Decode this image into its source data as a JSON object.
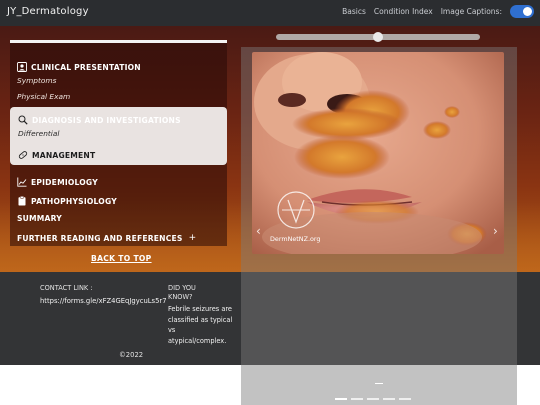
{
  "header": {
    "brand": "JY_Dermatology",
    "nav": [
      "Basics",
      "Condition Index",
      "Image Captions:"
    ],
    "captions_on": true
  },
  "menu": {
    "clinical": {
      "title": "CLINICAL PRESENTATION",
      "subs": [
        "Symptoms",
        "Physical Exam"
      ]
    },
    "diagnosis": {
      "title": "DIAGNOSIS AND INVESTIGATIONS",
      "subs": [
        "Differential"
      ]
    },
    "management": {
      "title": "MANAGEMENT"
    },
    "epidemiology": {
      "title": "EPIDEMIOLOGY"
    },
    "pathophysiology": {
      "title": "PATHOPHYSIOLOGY"
    },
    "summary": {
      "title": "SUMMARY"
    },
    "further": {
      "title": "FURTHER READING AND REFERENCES",
      "expand": "+"
    }
  },
  "back_to_top": "BACK TO TOP",
  "viewer": {
    "watermark": "DermNetNZ.org",
    "prev": "‹",
    "next": "›"
  },
  "footer": {
    "contact_label": "CONTACT LINK :",
    "contact_url": "https://forms.gle/xFZ4GEqJgycuLs5r7",
    "did_you_know": "DID YOU KNOW?",
    "fact": "Febrile seizures are classified as typical vs atypical/complex.",
    "copyright": "©2022"
  },
  "colors": {
    "navbar": "#2b2d30",
    "accent_toggle": "#2f6fd0",
    "active_menu_bg": "#e9e3e1"
  }
}
